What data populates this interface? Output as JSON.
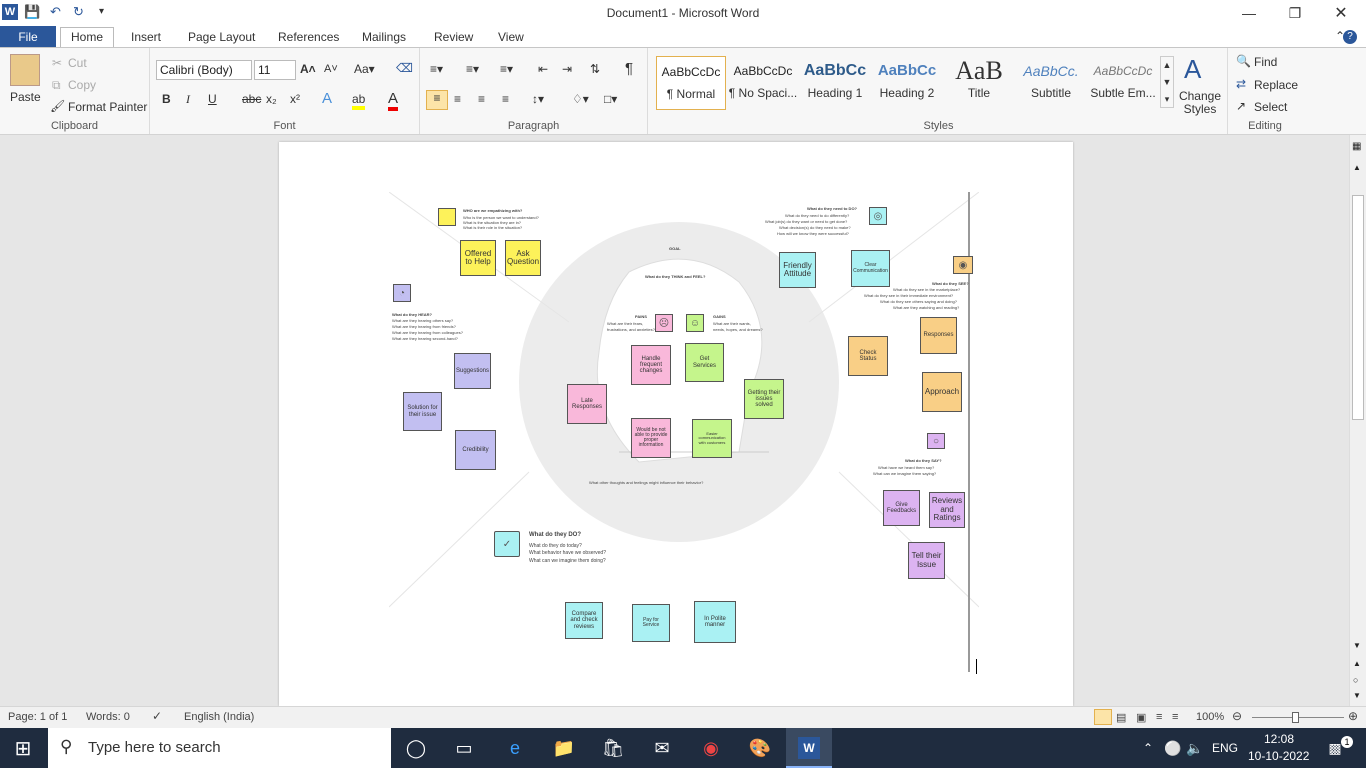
{
  "window": {
    "title": "Document1  -  Microsoft Word",
    "app_icon": "W"
  },
  "tabs": [
    "File",
    "Home",
    "Insert",
    "Page Layout",
    "References",
    "Mailings",
    "Review",
    "View"
  ],
  "clipboard": {
    "paste": "Paste",
    "cut": "Cut",
    "copy": "Copy",
    "format_painter": "Format Painter",
    "label": "Clipboard"
  },
  "font": {
    "name": "Calibri (Body)",
    "size": "11",
    "label": "Font"
  },
  "paragraph": {
    "label": "Paragraph"
  },
  "styles": {
    "items": [
      {
        "sample": "AaBbCcDc",
        "name": "¶ Normal"
      },
      {
        "sample": "AaBbCcDc",
        "name": "¶ No Spaci..."
      },
      {
        "sample": "AaBbCc",
        "name": "Heading 1"
      },
      {
        "sample": "AaBbCc",
        "name": "Heading 2"
      },
      {
        "sample": "AaB",
        "name": "Title"
      },
      {
        "sample": "AaBbCc.",
        "name": "Subtitle"
      },
      {
        "sample": "AaBbCcDc",
        "name": "Subtle Em..."
      }
    ],
    "change_styles": "Change Styles",
    "label": "Styles"
  },
  "editing": {
    "find": "Find",
    "replace": "Replace",
    "select": "Select",
    "label": "Editing"
  },
  "canvas": {
    "who_title": "WHO are we empathizing with?",
    "who_lines": [
      "Who is the person we want to understand?",
      "What is the situation they are in?",
      "What is their role in the situation?"
    ],
    "need_title": "What do they need to DO?",
    "need_lines": [
      "What do they need to do differently?",
      "What job(s) do they want or need to get done?",
      "What decision(s) do they need to make?",
      "How will we know they were successful?"
    ],
    "goal": "GOAL",
    "think_feel": "What do they THINK and FEEL?",
    "pains": "PAINS",
    "pains_lines": [
      "What are their fears,",
      "frustrations, and anxieties?"
    ],
    "gains": "GAINS",
    "gains_lines": [
      "What are their wants,",
      "needs, hopes, and dreams?"
    ],
    "hear_title": "What do they HEAR?",
    "hear_lines": [
      "What are they hearing others say?",
      "What are they hearing from friends?",
      "What are they hearing from colleagues?",
      "What are they hearing second-hand?"
    ],
    "see_title": "What do they SEE?",
    "see_lines": [
      "What do they see in the marketplace?",
      "What do they see in their immediate environment?",
      "What do they see others saying and doing?",
      "What are they watching and reading?"
    ],
    "say_title": "What do they SAY?",
    "say_lines": [
      "What have we heard them say?",
      "What can we imagine them saying?"
    ],
    "do_title": "What do they DO?",
    "do_lines": [
      "What do they do today?",
      "What behavior have we observed?",
      "What can we imagine them doing?"
    ],
    "other": "What other thoughts and feelings might influence their behavior?",
    "notes": {
      "offered": "Offered to Help",
      "ask": "Ask Question",
      "friendly": "Friendly Attitude",
      "clear": "Clear Communication",
      "suggestions": "Suggestions",
      "solution": "Solution for their issue",
      "credibility": "Credibility",
      "handle": "Handle frequent changes",
      "late": "Late Responses",
      "notable": "Would be not able to provide proper information",
      "get": "Get Services",
      "getting": "Getting their issues solved",
      "easier": "Easier communication with customers",
      "check": "Check Status",
      "responses": "Responses",
      "approach": "Approach",
      "feedback": "Give Feedbacks",
      "reviews": "Reviews and Ratings",
      "tell": "Tell their Issue",
      "compare": "Compare and check reviews",
      "pay": "Pay for Service",
      "polite": "In Polite manner"
    }
  },
  "status": {
    "page": "Page: 1 of 1",
    "words": "Words: 0",
    "language": "English (India)",
    "zoom": "100%"
  },
  "taskbar": {
    "search": "Type here to search",
    "lang": "ENG",
    "time": "12:08",
    "date": "10-10-2022",
    "notif": "1"
  },
  "colors": {
    "accent": "#2b579a",
    "yellow": "#fdf25a",
    "cyan": "#aaf1f3",
    "purple": "#c2bff1",
    "pink": "#f9b8da",
    "green": "#c5f58c",
    "orange": "#f9cf86",
    "violet": "#dcb3f1"
  }
}
